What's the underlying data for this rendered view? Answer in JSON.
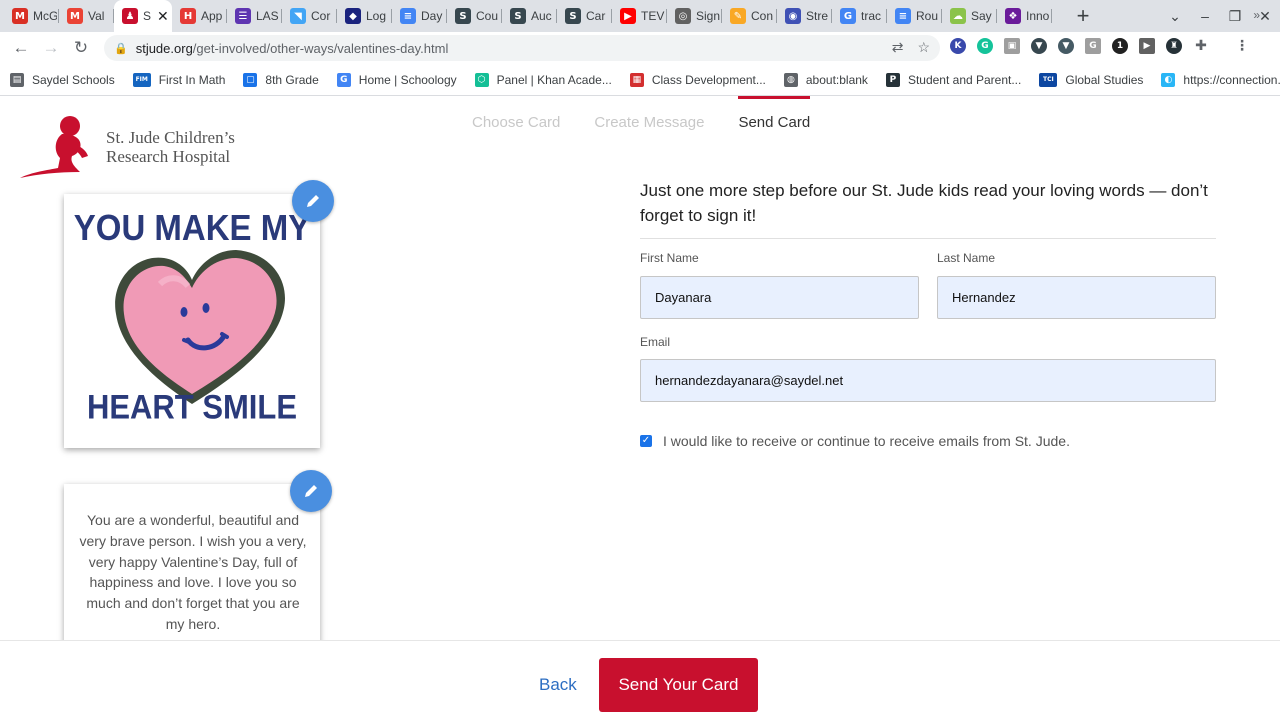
{
  "browser": {
    "tabs": [
      {
        "label": "McG",
        "fav_text": "M",
        "fav_color": "#d93025",
        "active": false
      },
      {
        "label": "Val",
        "fav_text": "M",
        "fav_color": "#ea4335",
        "active": false
      },
      {
        "label": "S",
        "fav_text": "♟",
        "fav_color": "#c8102e",
        "active": true
      },
      {
        "label": "App",
        "fav_text": "H",
        "fav_color": "#e53935",
        "active": false
      },
      {
        "label": "LAS",
        "fav_text": "☰",
        "fav_color": "#5e35b1",
        "active": false
      },
      {
        "label": "Cor",
        "fav_text": "◥",
        "fav_color": "#42a5f5",
        "active": false
      },
      {
        "label": "Log",
        "fav_text": "◆",
        "fav_color": "#1a237e",
        "active": false
      },
      {
        "label": "Day",
        "fav_text": "≡",
        "fav_color": "#4285f4",
        "active": false
      },
      {
        "label": "Cou",
        "fav_text": "S",
        "fav_color": "#37474f",
        "active": false
      },
      {
        "label": "Auc",
        "fav_text": "S",
        "fav_color": "#37474f",
        "active": false
      },
      {
        "label": "Car",
        "fav_text": "S",
        "fav_color": "#37474f",
        "active": false
      },
      {
        "label": "TEV",
        "fav_text": "▶",
        "fav_color": "#ff0000",
        "active": false
      },
      {
        "label": "Sign",
        "fav_text": "◎",
        "fav_color": "#616161",
        "active": false
      },
      {
        "label": "Con",
        "fav_text": "✎",
        "fav_color": "#f9a825",
        "active": false
      },
      {
        "label": "Stre",
        "fav_text": "◉",
        "fav_color": "#3f51b5",
        "active": false
      },
      {
        "label": "trac",
        "fav_text": "G",
        "fav_color": "#4285f4",
        "active": false
      },
      {
        "label": "Rou",
        "fav_text": "≡",
        "fav_color": "#4285f4",
        "active": false
      },
      {
        "label": "Say",
        "fav_text": "☁",
        "fav_color": "#8bc34a",
        "active": false
      },
      {
        "label": "Inno",
        "fav_text": "❖",
        "fav_color": "#6a1b9a",
        "active": false
      }
    ],
    "url_host": "stjude.org",
    "url_path": "/get-involved/other-ways/valentines-day.html",
    "bookmarks": [
      {
        "label": "Saydel Schools",
        "fav_text": "▤",
        "fav_color": "#5f6368"
      },
      {
        "label": "First In Math",
        "fav_text": "FIM",
        "fav_color": "#1565c0"
      },
      {
        "label": "8th Grade",
        "fav_text": "▢",
        "fav_color": "#1a73e8"
      },
      {
        "label": "Home | Schoology",
        "fav_text": "G",
        "fav_color": "#4285f4"
      },
      {
        "label": "Panel | Khan Acade...",
        "fav_text": "⬡",
        "fav_color": "#14bf96"
      },
      {
        "label": "Class Development...",
        "fav_text": "▦",
        "fav_color": "#d32f2f"
      },
      {
        "label": "about:blank",
        "fav_text": "◍",
        "fav_color": "#5f6368"
      },
      {
        "label": "Student and Parent...",
        "fav_text": "P",
        "fav_color": "#263238"
      },
      {
        "label": "Global Studies",
        "fav_text": "TCI",
        "fav_color": "#0d47a1"
      },
      {
        "label": "https://connection....",
        "fav_text": "◐",
        "fav_color": "#29b6f6"
      }
    ],
    "more_bookmarks": "»"
  },
  "site": {
    "logo_line1": "St. Jude Children’s",
    "logo_line2": "Research Hospital",
    "brand_color": "#c8102e"
  },
  "steps": [
    "Choose Card",
    "Create Message",
    "Send Card"
  ],
  "current_step": "Send Card",
  "card": {
    "title_line1": "YOU MAKE MY",
    "title_line2": "HEART SMILE",
    "message": "You are a wonderful, beautiful and very brave person. I wish you a very, very happy Valentine’s Day, full of happiness and love. I love you so much and don’t forget that you are my hero."
  },
  "form": {
    "heading": "Just one more step before our St. Jude kids read your loving words — don’t forget to sign it!",
    "first_name_label": "First Name",
    "first_name_value": "Dayanara",
    "last_name_label": "Last Name",
    "last_name_value": "Hernandez",
    "email_label": "Email",
    "email_value": "hernandezdayanara@saydel.net",
    "optin_label": "I would like to receive or continue to receive emails from St. Jude.",
    "optin_checked": true
  },
  "footer": {
    "back_label": "Back",
    "send_label": "Send Your Card"
  }
}
